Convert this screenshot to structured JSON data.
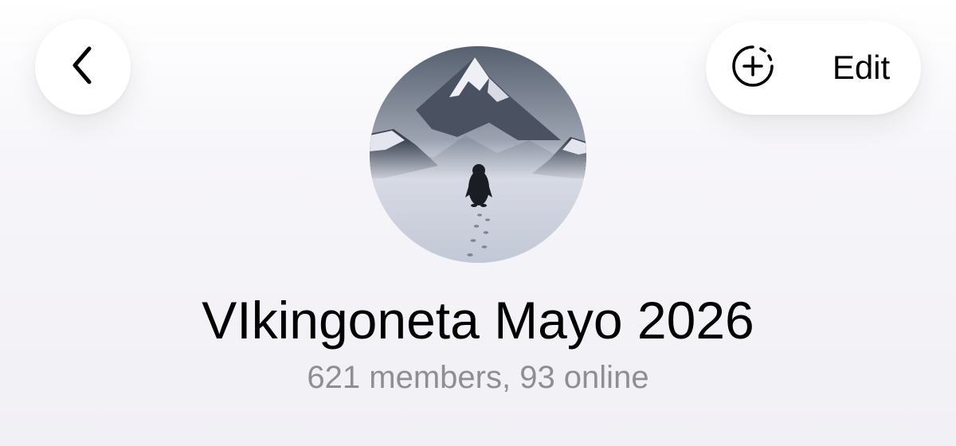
{
  "header": {
    "back_icon": "chevron-left-icon",
    "add_story_icon": "add-story-icon",
    "edit_label": "Edit"
  },
  "profile": {
    "title": "VIkingoneta Mayo 2026",
    "subtitle": "621 members, 93 online",
    "avatar_description_icon": "mountain-penguin-avatar"
  },
  "colors": {
    "background": "#f1f0f5",
    "button_bg": "#ffffff",
    "title_text": "#000000",
    "subtitle_text": "#8e8e93"
  }
}
